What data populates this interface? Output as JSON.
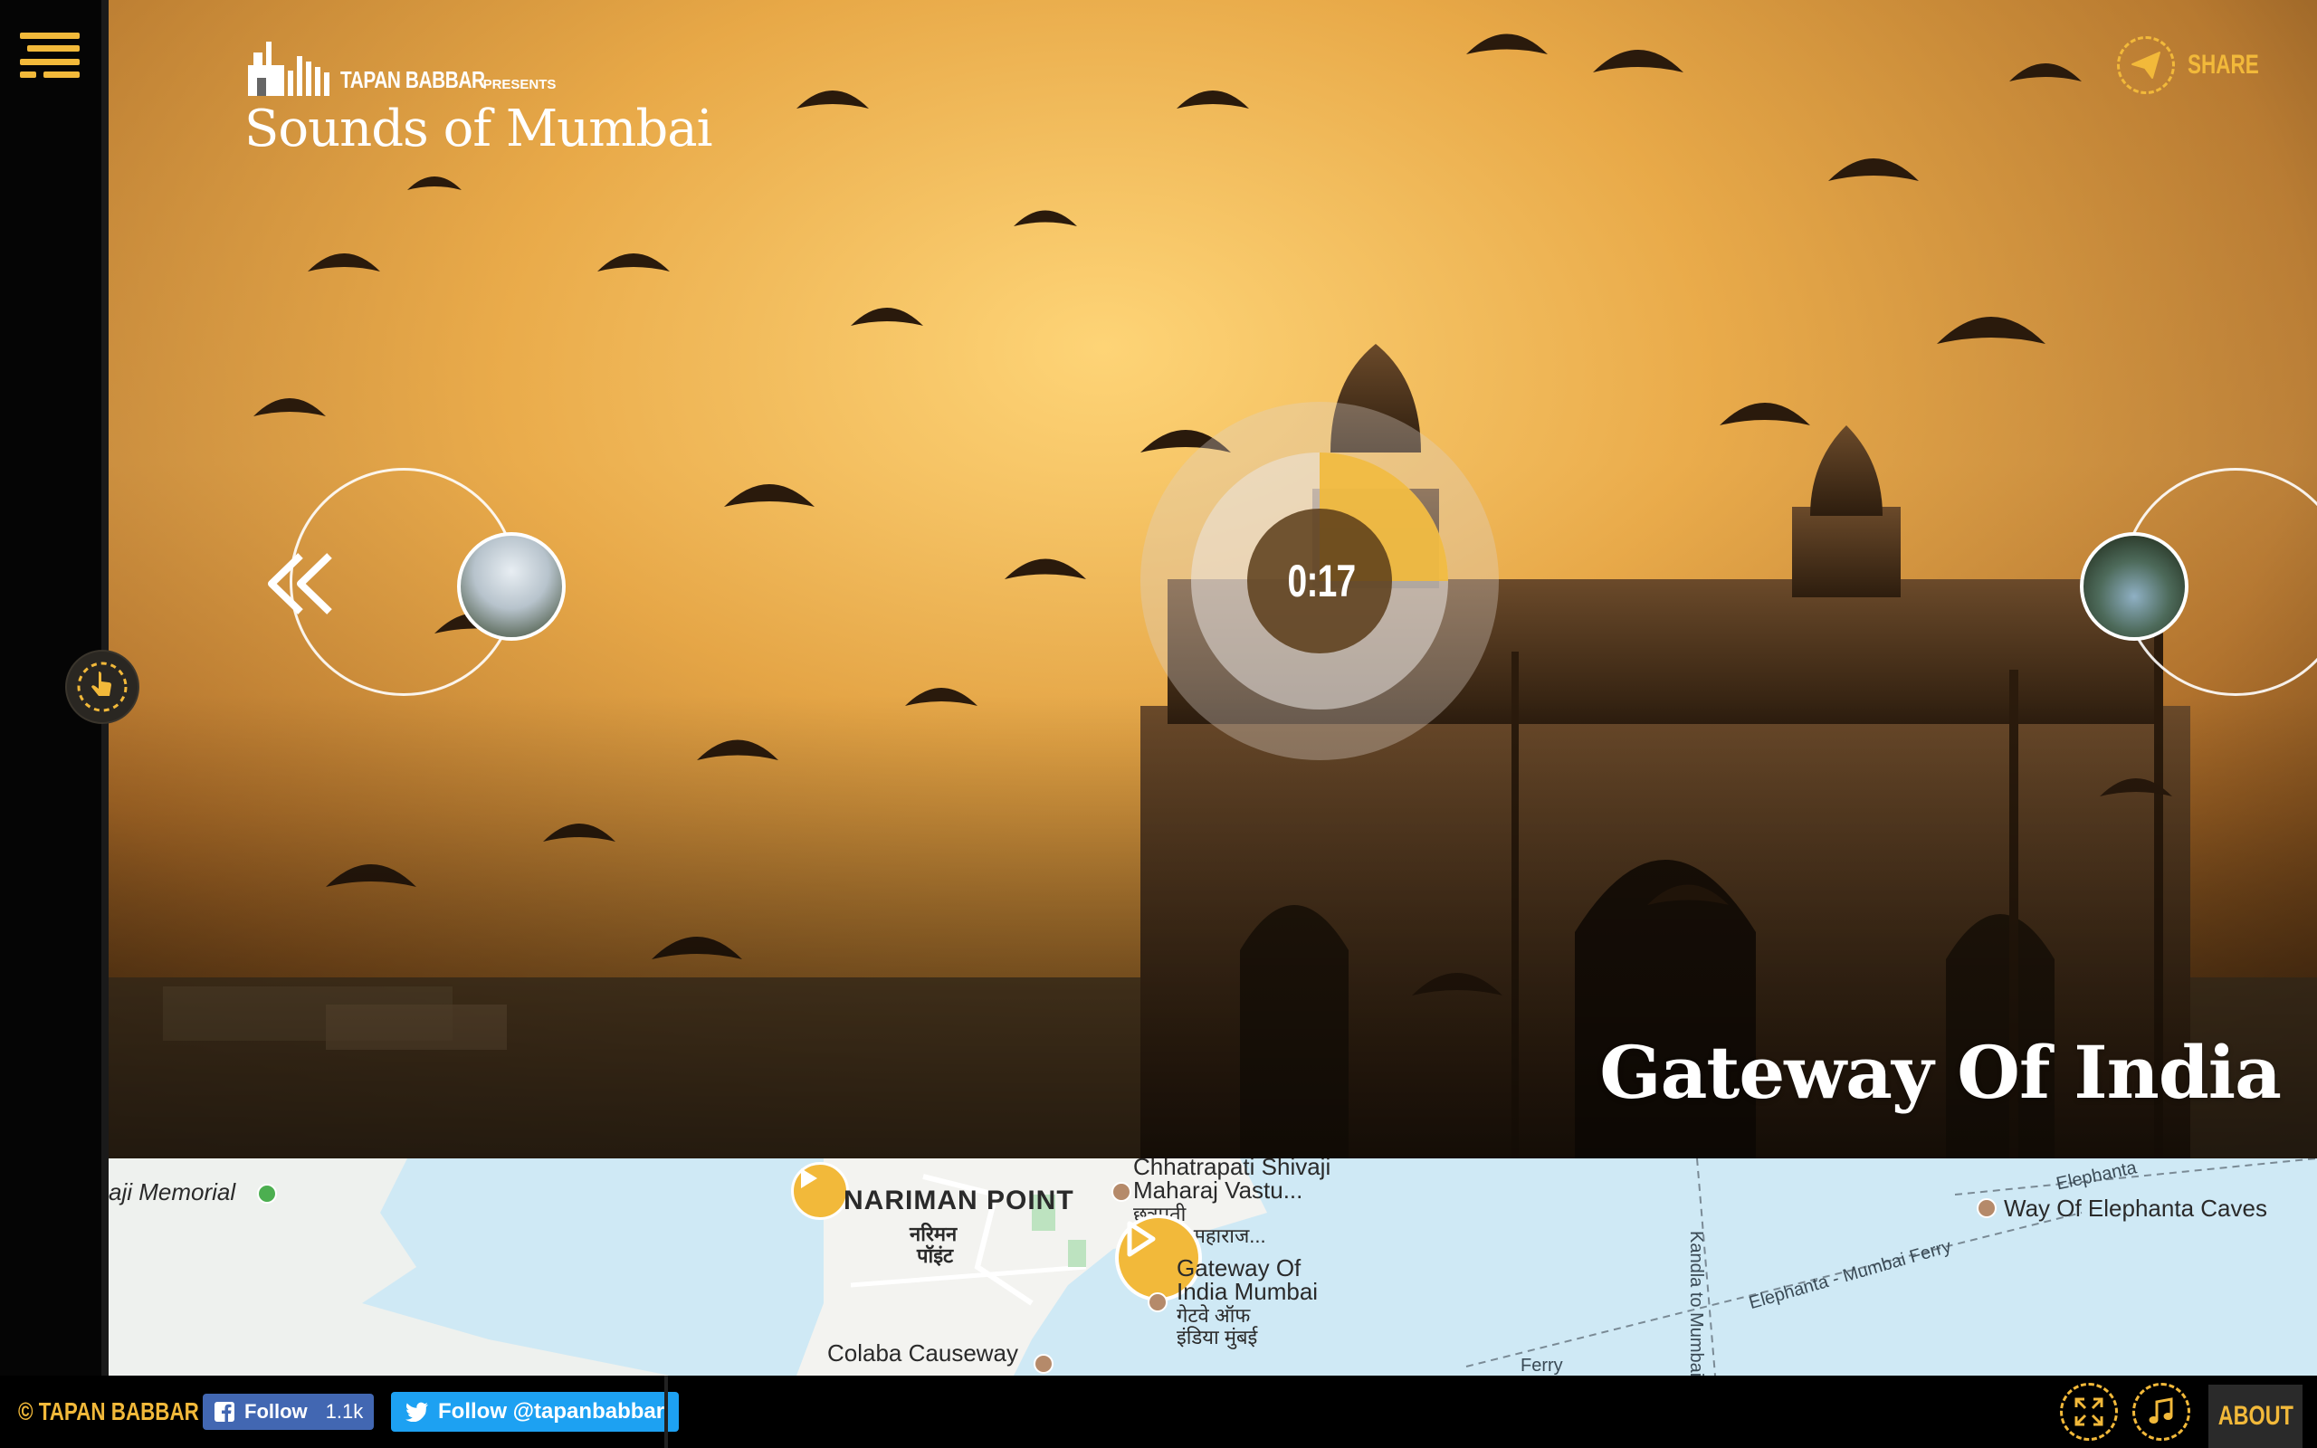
{
  "brand": {
    "name": "TAPAN BABBAR",
    "presents": "PRESENTS",
    "title": "Sounds of Mumbai"
  },
  "share": {
    "label": "SHARE",
    "icon": "paper-plane-icon"
  },
  "player": {
    "elapsed": "0:17",
    "progress_fraction": 0.25,
    "accent": "#f2b93a"
  },
  "current_place": "Gateway Of India",
  "map": {
    "labels": [
      {
        "text": "aji Memorial",
        "kind": "italic"
      },
      {
        "text": "NARIMAN POINT",
        "kind": "bold"
      },
      {
        "text": "नरिमन",
        "kind": "dev"
      },
      {
        "text": "पॉइंट",
        "kind": "dev"
      },
      {
        "text": "Chhatrapati Shivaji",
        "kind": "normal"
      },
      {
        "text": "Maharaj Vastu...",
        "kind": "normal"
      },
      {
        "text": "छत्रपती",
        "kind": "normal"
      },
      {
        "text": "शिवाजी महाराज...",
        "kind": "normal"
      },
      {
        "text": "Gateway Of",
        "kind": "normal"
      },
      {
        "text": "India Mumbai",
        "kind": "normal"
      },
      {
        "text": "गेटवे ऑफ",
        "kind": "normal"
      },
      {
        "text": "इंडिया मुंबई",
        "kind": "normal"
      },
      {
        "text": "Colaba Causeway",
        "kind": "normal"
      },
      {
        "text": "Kandla to Mumbai",
        "kind": "small"
      },
      {
        "text": "Elephanta - Mumbai Ferry",
        "kind": "small"
      },
      {
        "text": "Elephanta",
        "kind": "small"
      },
      {
        "text": "Way Of Elephanta Caves",
        "kind": "normal"
      },
      {
        "text": "Ferry",
        "kind": "small"
      }
    ]
  },
  "footer": {
    "copyright": "© TAPAN BABBAR",
    "facebook_label": "Follow",
    "facebook_count": "1.1k",
    "twitter_label": "Follow @tapanbabbar",
    "about_label": "ABOUT"
  }
}
